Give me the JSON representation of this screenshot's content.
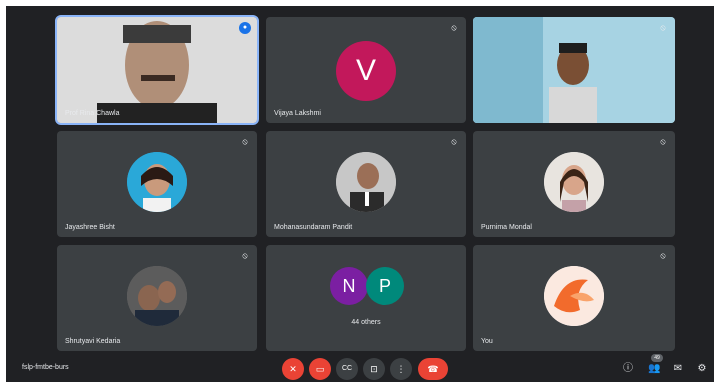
{
  "meeting": {
    "title": "fslp-fmtbe-burs"
  },
  "participants": [
    {
      "id": "p1",
      "name": "Prof Rina Chawla",
      "type": "video",
      "active": true
    },
    {
      "id": "p2",
      "name": "Vijaya Lakshmi",
      "type": "letter",
      "letter": "V",
      "color": "#c2185b"
    },
    {
      "id": "p3",
      "name": "",
      "type": "video"
    },
    {
      "id": "p4",
      "name": "Jayashree Bisht",
      "type": "photo"
    },
    {
      "id": "p5",
      "name": "Mohanasundaram Pandit",
      "type": "photo"
    },
    {
      "id": "p6",
      "name": "Purnima Mondal",
      "type": "photo"
    },
    {
      "id": "p7",
      "name": "Shrutyavi Kedaria",
      "type": "photo"
    },
    {
      "id": "p8",
      "name": "44 others",
      "type": "group",
      "letters": [
        "N",
        "P"
      ],
      "colors": [
        "#7b1fa2",
        "#00897b"
      ]
    },
    {
      "id": "p9",
      "name": "You",
      "type": "photo"
    }
  ],
  "icons": {
    "mic_off": "mic-off-icon",
    "speaking": "speaking-icon"
  },
  "controls": [
    {
      "id": "mic",
      "icon": "mic-off-icon",
      "symbol": "✕"
    },
    {
      "id": "cam",
      "icon": "camera-off-icon",
      "symbol": "▭"
    },
    {
      "id": "cc",
      "icon": "captions-icon",
      "symbol": "CC"
    },
    {
      "id": "present",
      "icon": "present-icon",
      "symbol": "⊡"
    },
    {
      "id": "more",
      "icon": "more-options-icon",
      "symbol": "⋮"
    },
    {
      "id": "hangup",
      "icon": "hang-up-icon",
      "symbol": "☎"
    }
  ],
  "right_controls": [
    {
      "id": "info",
      "icon": "info-icon",
      "symbol": "ⓘ"
    },
    {
      "id": "people",
      "icon": "people-icon",
      "symbol": "👥",
      "badge": "49"
    },
    {
      "id": "chat",
      "icon": "chat-icon",
      "symbol": "✉"
    },
    {
      "id": "activities",
      "icon": "activities-icon",
      "symbol": "⚙"
    }
  ]
}
